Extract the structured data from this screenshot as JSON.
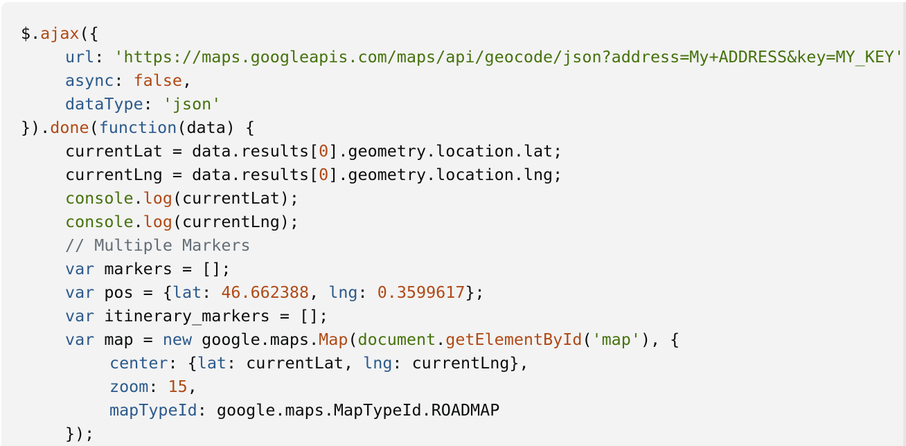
{
  "code_lines": [
    {
      "indent": 0,
      "tokens": [
        {
          "t": "p",
          "v": "$."
        },
        {
          "t": "n",
          "v": "ajax"
        },
        {
          "t": "p",
          "v": "({"
        }
      ]
    },
    {
      "indent": 1,
      "tokens": [
        {
          "t": "k",
          "v": "url"
        },
        {
          "t": "p",
          "v": ": "
        },
        {
          "t": "s",
          "v": "'https://maps.googleapis.com/maps/api/geocode/json?address=My+ADDRESS&key=MY_KEY'"
        }
      ]
    },
    {
      "indent": 1,
      "tokens": [
        {
          "t": "k",
          "v": "async"
        },
        {
          "t": "p",
          "v": ": "
        },
        {
          "t": "n",
          "v": "false"
        },
        {
          "t": "p",
          "v": ","
        }
      ]
    },
    {
      "indent": 1,
      "tokens": [
        {
          "t": "k",
          "v": "dataType"
        },
        {
          "t": "p",
          "v": ": "
        },
        {
          "t": "s",
          "v": "'json'"
        }
      ]
    },
    {
      "indent": 0,
      "tokens": [
        {
          "t": "p",
          "v": "})."
        },
        {
          "t": "n",
          "v": "done"
        },
        {
          "t": "p",
          "v": "("
        },
        {
          "t": "k",
          "v": "function"
        },
        {
          "t": "p",
          "v": "(data) {"
        }
      ]
    },
    {
      "indent": 1,
      "tokens": [
        {
          "t": "p",
          "v": "currentLat = data.results["
        },
        {
          "t": "n",
          "v": "0"
        },
        {
          "t": "p",
          "v": "].geometry.location.lat;"
        }
      ]
    },
    {
      "indent": 1,
      "tokens": [
        {
          "t": "p",
          "v": "currentLng = data.results["
        },
        {
          "t": "n",
          "v": "0"
        },
        {
          "t": "p",
          "v": "].geometry.location.lng;"
        }
      ]
    },
    {
      "indent": 1,
      "tokens": [
        {
          "t": "s",
          "v": "console"
        },
        {
          "t": "p",
          "v": "."
        },
        {
          "t": "n",
          "v": "log"
        },
        {
          "t": "p",
          "v": "(currentLat);"
        }
      ]
    },
    {
      "indent": 1,
      "tokens": [
        {
          "t": "s",
          "v": "console"
        },
        {
          "t": "p",
          "v": "."
        },
        {
          "t": "n",
          "v": "log"
        },
        {
          "t": "p",
          "v": "(currentLng);"
        }
      ]
    },
    {
      "indent": 1,
      "tokens": [
        {
          "t": "c",
          "v": "// Multiple Markers"
        }
      ]
    },
    {
      "indent": 1,
      "tokens": [
        {
          "t": "k",
          "v": "var"
        },
        {
          "t": "p",
          "v": " markers = [];"
        }
      ]
    },
    {
      "indent": 1,
      "tokens": [
        {
          "t": "k",
          "v": "var"
        },
        {
          "t": "p",
          "v": " pos = {"
        },
        {
          "t": "k",
          "v": "lat"
        },
        {
          "t": "p",
          "v": ": "
        },
        {
          "t": "n",
          "v": "46.662388"
        },
        {
          "t": "p",
          "v": ", "
        },
        {
          "t": "k",
          "v": "lng"
        },
        {
          "t": "p",
          "v": ": "
        },
        {
          "t": "n",
          "v": "0.3599617"
        },
        {
          "t": "p",
          "v": "};"
        }
      ]
    },
    {
      "indent": 1,
      "tokens": [
        {
          "t": "k",
          "v": "var"
        },
        {
          "t": "p",
          "v": " itinerary_markers = [];"
        }
      ]
    },
    {
      "indent": 1,
      "tokens": [
        {
          "t": "k",
          "v": "var"
        },
        {
          "t": "p",
          "v": " map = "
        },
        {
          "t": "k",
          "v": "new"
        },
        {
          "t": "p",
          "v": " google.maps."
        },
        {
          "t": "n",
          "v": "Map"
        },
        {
          "t": "p",
          "v": "("
        },
        {
          "t": "s",
          "v": "document"
        },
        {
          "t": "p",
          "v": "."
        },
        {
          "t": "n",
          "v": "getElementById"
        },
        {
          "t": "p",
          "v": "("
        },
        {
          "t": "s",
          "v": "'map'"
        },
        {
          "t": "p",
          "v": "), {"
        }
      ]
    },
    {
      "indent": 2,
      "tokens": [
        {
          "t": "k",
          "v": "center"
        },
        {
          "t": "p",
          "v": ": {"
        },
        {
          "t": "k",
          "v": "lat"
        },
        {
          "t": "p",
          "v": ": currentLat, "
        },
        {
          "t": "k",
          "v": "lng"
        },
        {
          "t": "p",
          "v": ": currentLng},"
        }
      ]
    },
    {
      "indent": 2,
      "tokens": [
        {
          "t": "k",
          "v": "zoom"
        },
        {
          "t": "p",
          "v": ": "
        },
        {
          "t": "n",
          "v": "15"
        },
        {
          "t": "p",
          "v": ","
        }
      ]
    },
    {
      "indent": 2,
      "tokens": [
        {
          "t": "k",
          "v": "mapTypeId"
        },
        {
          "t": "p",
          "v": ": google.maps.MapTypeId.ROADMAP"
        }
      ]
    },
    {
      "indent": 1,
      "tokens": [
        {
          "t": "p",
          "v": "});"
        }
      ]
    }
  ],
  "colors": {
    "background": "#f3f3f3",
    "plain": "#0c0d0e",
    "keyword": "#2c5a8c",
    "string": "#46720d",
    "number": "#b04a16",
    "comment": "#656e77"
  }
}
